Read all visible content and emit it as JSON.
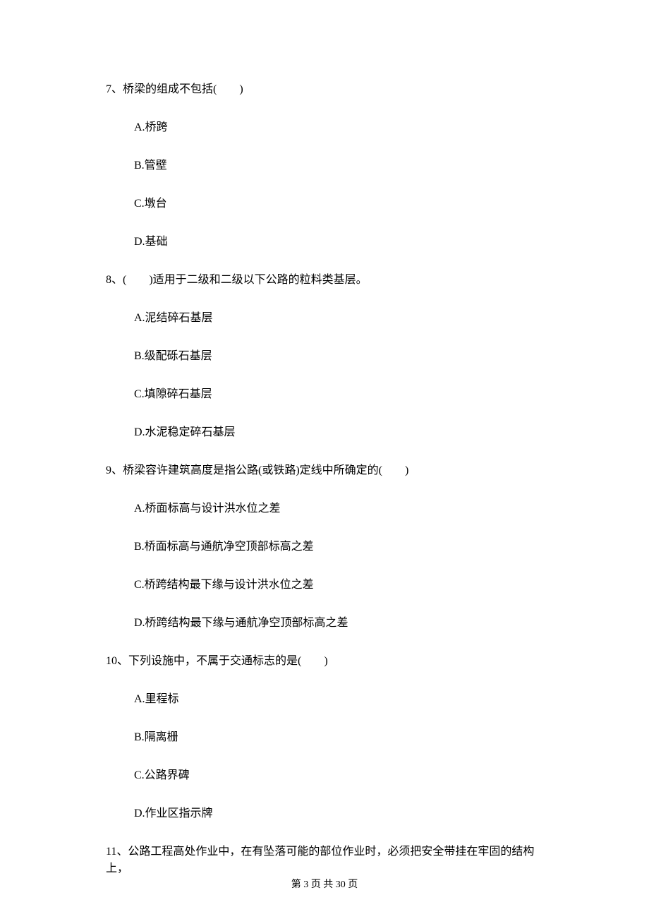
{
  "questions": [
    {
      "number": "7、",
      "text": "桥梁的组成不包括(　　)",
      "options": [
        "A.桥跨",
        "B.管壁",
        "C.墩台",
        "D.基础"
      ]
    },
    {
      "number": "8、",
      "text": "(　　)适用于二级和二级以下公路的粒料类基层。",
      "options": [
        "A.泥结碎石基层",
        "B.级配砾石基层",
        "C.填隙碎石基层",
        "D.水泥稳定碎石基层"
      ]
    },
    {
      "number": "9、",
      "text": "桥梁容许建筑高度是指公路(或铁路)定线中所确定的(　　)",
      "options": [
        "A.桥面标高与设计洪水位之差",
        "B.桥面标高与通航净空顶部标高之差",
        "C.桥跨结构最下缘与设计洪水位之差",
        "D.桥跨结构最下缘与通航净空顶部标高之差"
      ]
    },
    {
      "number": "10、",
      "text": "下列设施中，不属于交通标志的是(　　)",
      "options": [
        "A.里程标",
        "B.隔离栅",
        "C.公路界碑",
        "D.作业区指示牌"
      ]
    },
    {
      "number": "11、",
      "text": "公路工程高处作业中，在有坠落可能的部位作业时，必须把安全带挂在牢固的结构上，",
      "options": []
    }
  ],
  "footer": "第 3 页 共 30 页"
}
